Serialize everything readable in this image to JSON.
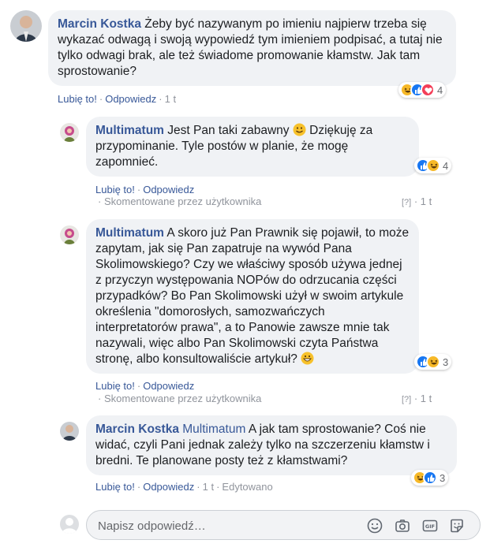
{
  "comments": [
    {
      "author": "Marcin Kostka",
      "text": "Żeby być nazywanym po imieniu najpierw trzeba się wykazać odwagą i swoją wypowiedź tym imieniem podpisać, a tutaj nie tylko odwagi brak, ale też świadome promowanie kłamstw. Jak tam sprostowanie?",
      "reactions": [
        "haha",
        "like",
        "love"
      ],
      "reaction_count": "4",
      "like_label": "Lubię to!",
      "reply_label": "Odpowiedz",
      "time": "1 t"
    }
  ],
  "replies": [
    {
      "author": "Multimatum",
      "text_before": "Jest Pan taki zabawny",
      "text_after": "Dziękuję za przypominanie. Tyle postów w planie, że mogę zapomnieć.",
      "reactions": [
        "like",
        "haha"
      ],
      "reaction_count": "4",
      "like_label": "Lubię to!",
      "reply_label": "Odpowiedz",
      "sub_label": "Skomentowane przez użytkownika",
      "qmark": "[?]",
      "time": "1 t"
    },
    {
      "author": "Multimatum",
      "text": "A skoro już Pan Prawnik się pojawił, to może zapytam, jak się Pan zapatruje na wywód Pana Skolimowskiego? Czy we właściwy sposób używa jednej z przyczyn występowania NOPów do odrzucania części przypadków? Bo Pan Skolimowski użył w swoim artykule określenia \"domorosłych, samozwańczych interpretatorów prawa\", a to Panowie zawsze mnie tak nazywali, więc albo Pan Skolimowski czyta Państwa stronę, albo konsultowaliście artykuł?",
      "reactions": [
        "like",
        "haha"
      ],
      "reaction_count": "3",
      "like_label": "Lubię to!",
      "reply_label": "Odpowiedz",
      "sub_label": "Skomentowane przez użytkownika",
      "qmark": "[?]",
      "time": "1 t"
    },
    {
      "author": "Marcin Kostka",
      "mention": "Multimatum",
      "text": "A jak tam sprostowanie? Coś nie widać, czyli Pani jednak zależy tylko na szczerzeniu kłamstw i bredni. Te planowane posty też z kłamstwami?",
      "reactions": [
        "haha",
        "like"
      ],
      "reaction_count": "3",
      "like_label": "Lubię to!",
      "reply_label": "Odpowiedz",
      "time": "1 t",
      "edited_label": "Edytowano"
    }
  ],
  "reply_box": {
    "placeholder": "Napisz odpowiedź…",
    "icons": [
      "emoji-icon",
      "camera-icon",
      "gif-icon",
      "sticker-icon"
    ]
  },
  "colors": {
    "link": "#385898",
    "bubble": "#f0f2f5",
    "like": "#1877f2",
    "haha": "#f7b928",
    "love": "#f33e58"
  }
}
